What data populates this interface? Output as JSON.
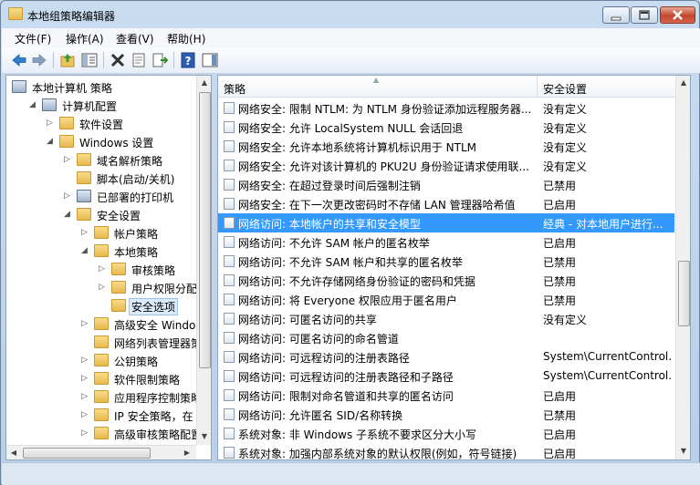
{
  "window": {
    "title": "本地组策略编辑器"
  },
  "menu": [
    "文件(F)",
    "操作(A)",
    "查看(V)",
    "帮助(H)"
  ],
  "toolbar": [
    "back-arrow-icon",
    "forward-arrow-icon",
    "up-folder-icon",
    "show-hide-tree-icon",
    "delete-icon",
    "properties-icon",
    "export-list-icon",
    "help-icon",
    "show-console-icon"
  ],
  "tree": [
    {
      "label": "本地计算机 策略",
      "level": 0,
      "arrow": "",
      "icon": "computer-policy-icon"
    },
    {
      "label": "计算机配置",
      "level": 1,
      "arrow": "▲",
      "icon": "computer-icon"
    },
    {
      "label": "软件设置",
      "level": 2,
      "arrow": "▷",
      "icon": "folder-icon"
    },
    {
      "label": "Windows 设置",
      "level": 2,
      "arrow": "▲",
      "icon": "folder-icon"
    },
    {
      "label": "域名解析策略",
      "level": 3,
      "arrow": "▷",
      "icon": "dns-policy-icon"
    },
    {
      "label": "脚本(启动/关机)",
      "level": 3,
      "arrow": "",
      "icon": "script-icon"
    },
    {
      "label": "已部署的打印机",
      "level": 3,
      "arrow": "▷",
      "icon": "printer-icon"
    },
    {
      "label": "安全设置",
      "level": 3,
      "arrow": "▲",
      "icon": "security-icon"
    },
    {
      "label": "帐户策略",
      "level": 4,
      "arrow": "▷",
      "icon": "folder-lock-icon"
    },
    {
      "label": "本地策略",
      "level": 4,
      "arrow": "▲",
      "icon": "folder-lock-icon"
    },
    {
      "label": "审核策略",
      "level": 5,
      "arrow": "▷",
      "icon": "folder-lock-icon"
    },
    {
      "label": "用户权限分配",
      "level": 5,
      "arrow": "▷",
      "icon": "folder-lock-icon"
    },
    {
      "label": "安全选项",
      "level": 5,
      "arrow": "",
      "icon": "folder-lock-icon",
      "selected": true
    },
    {
      "label": "高级安全 Windows",
      "level": 4,
      "arrow": "▷",
      "icon": "folder-icon"
    },
    {
      "label": "网络列表管理器策略",
      "level": 4,
      "arrow": "",
      "icon": "folder-icon"
    },
    {
      "label": "公钥策略",
      "level": 4,
      "arrow": "▷",
      "icon": "folder-icon"
    },
    {
      "label": "软件限制策略",
      "level": 4,
      "arrow": "▷",
      "icon": "folder-icon"
    },
    {
      "label": "应用程序控制策略",
      "level": 4,
      "arrow": "▷",
      "icon": "folder-icon"
    },
    {
      "label": "IP 安全策略，在 本:",
      "level": 4,
      "arrow": "▷",
      "icon": "ip-security-icon"
    },
    {
      "label": "高级审核策略配置",
      "level": 4,
      "arrow": "▷",
      "icon": "folder-icon"
    }
  ],
  "list": {
    "columns": [
      "策略",
      "安全设置"
    ],
    "rows": [
      {
        "policy": "网络安全: 限制 NTLM: 为 NTLM 身份验证添加远程服务器...",
        "setting": "没有定义"
      },
      {
        "policy": "网络安全: 允许 LocalSystem NULL 会话回退",
        "setting": "没有定义"
      },
      {
        "policy": "网络安全: 允许本地系统将计算机标识用于 NTLM",
        "setting": "没有定义"
      },
      {
        "policy": "网络安全: 允许对该计算机的 PKU2U 身份验证请求使用联...",
        "setting": "没有定义"
      },
      {
        "policy": "网络安全: 在超过登录时间后强制注销",
        "setting": "已禁用"
      },
      {
        "policy": "网络安全: 在下一次更改密码时不存储 LAN 管理器哈希值",
        "setting": "已启用"
      },
      {
        "policy": "网络访问: 本地帐户的共享和安全模型",
        "setting": "经典 - 对本地用户进行...",
        "selected": true
      },
      {
        "policy": "网络访问: 不允许 SAM 帐户的匿名枚举",
        "setting": "已启用"
      },
      {
        "policy": "网络访问: 不允许 SAM 帐户和共享的匿名枚举",
        "setting": "已禁用"
      },
      {
        "policy": "网络访问: 不允许存储网络身份验证的密码和凭据",
        "setting": "已禁用"
      },
      {
        "policy": "网络访问: 将 Everyone 权限应用于匿名用户",
        "setting": "已禁用"
      },
      {
        "policy": "网络访问: 可匿名访问的共享",
        "setting": "没有定义"
      },
      {
        "policy": "网络访问: 可匿名访问的命名管道",
        "setting": ""
      },
      {
        "policy": "网络访问: 可远程访问的注册表路径",
        "setting": "System\\CurrentControl..."
      },
      {
        "policy": "网络访问: 可远程访问的注册表路径和子路径",
        "setting": "System\\CurrentControl..."
      },
      {
        "policy": "网络访问: 限制对命名管道和共享的匿名访问",
        "setting": "已启用"
      },
      {
        "policy": "网络访问: 允许匿名 SID/名称转换",
        "setting": "已禁用"
      },
      {
        "policy": "系统对象: 非 Windows 子系统不要求区分大小写",
        "setting": "已启用"
      },
      {
        "policy": "系统对象: 加强内部系统对象的默认权限(例如，符号链接)",
        "setting": "已启用"
      }
    ]
  }
}
